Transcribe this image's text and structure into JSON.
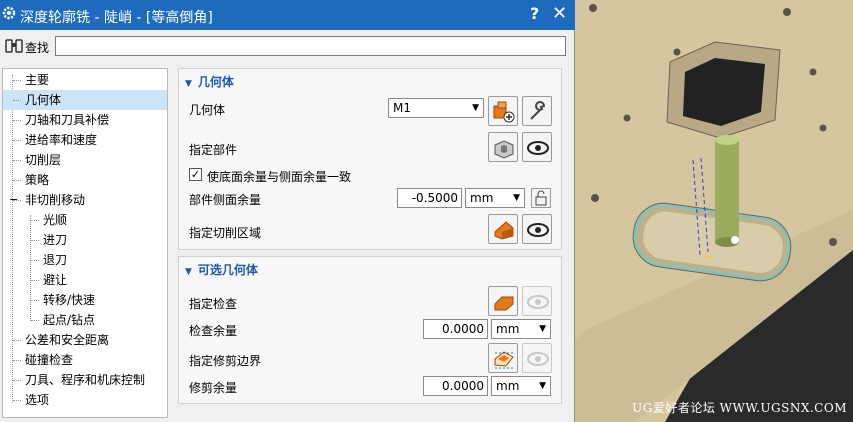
{
  "window": {
    "title": "深度轮廓铣 - 陡峭 - [等高倒角]",
    "help_label": "?",
    "close_label": "✕"
  },
  "search": {
    "label": "查找",
    "value": ""
  },
  "tree": {
    "items": [
      {
        "label": "主要",
        "level": 0,
        "selected": false
      },
      {
        "label": "几何体",
        "level": 0,
        "selected": true
      },
      {
        "label": "刀轴和刀具补偿",
        "level": 0,
        "selected": false
      },
      {
        "label": "进给率和速度",
        "level": 0,
        "selected": false
      },
      {
        "label": "切削层",
        "level": 0,
        "selected": false
      },
      {
        "label": "策略",
        "level": 0,
        "selected": false
      },
      {
        "label": "非切削移动",
        "level": 0,
        "selected": false,
        "expanded": true,
        "expander": "−"
      },
      {
        "label": "光顺",
        "level": 1,
        "selected": false
      },
      {
        "label": "进刀",
        "level": 1,
        "selected": false
      },
      {
        "label": "退刀",
        "level": 1,
        "selected": false
      },
      {
        "label": "避让",
        "level": 1,
        "selected": false
      },
      {
        "label": "转移/快速",
        "level": 1,
        "selected": false
      },
      {
        "label": "起点/钻点",
        "level": 1,
        "selected": false
      },
      {
        "label": "公差和安全距离",
        "level": 0,
        "selected": false
      },
      {
        "label": "碰撞检查",
        "level": 0,
        "selected": false
      },
      {
        "label": "刀具、程序和机床控制",
        "level": 0,
        "selected": false
      },
      {
        "label": "选项",
        "level": 0,
        "selected": false
      }
    ]
  },
  "geometry_group": {
    "title": "几何体",
    "geometry_label": "几何体",
    "geometry_value": "M1",
    "specify_part_label": "指定部件",
    "checkbox_label": "使底面余量与侧面余量一致",
    "checkbox_checked": true,
    "checkbox_mark": "✓",
    "part_side_stock_label": "部件侧面余量",
    "part_side_stock_value": "-0.5000",
    "part_side_stock_unit": "mm",
    "cut_area_label": "指定切削区域"
  },
  "optional_group": {
    "title": "可选几何体",
    "check_label": "指定检查",
    "check_stock_label": "检查余量",
    "check_stock_value": "0.0000",
    "check_stock_unit": "mm",
    "trim_boundary_label": "指定修剪边界",
    "trim_stock_label": "修剪余量",
    "trim_stock_value": "0.0000",
    "trim_stock_unit": "mm"
  },
  "icons": {
    "geometry_new": "geometry-new-icon",
    "edit": "wrench-icon",
    "part": "part-select-icon",
    "display": "eye-icon",
    "cut_area": "cut-area-icon",
    "check": "check-geometry-icon",
    "trim": "trim-boundary-icon",
    "lock": "lock-icon"
  },
  "viewport": {
    "watermark": "UG爱好者论坛 WWW.UGSNX.COM"
  },
  "colors": {
    "titlebar": "#1d6bbd",
    "group_title": "#1c5aa8",
    "tree_selection": "#cce4f7",
    "model_body": "#d4c4a0",
    "tool": "#9aab5c",
    "toolpath": "#4fd2e6",
    "icon_orange": "#e67817"
  }
}
